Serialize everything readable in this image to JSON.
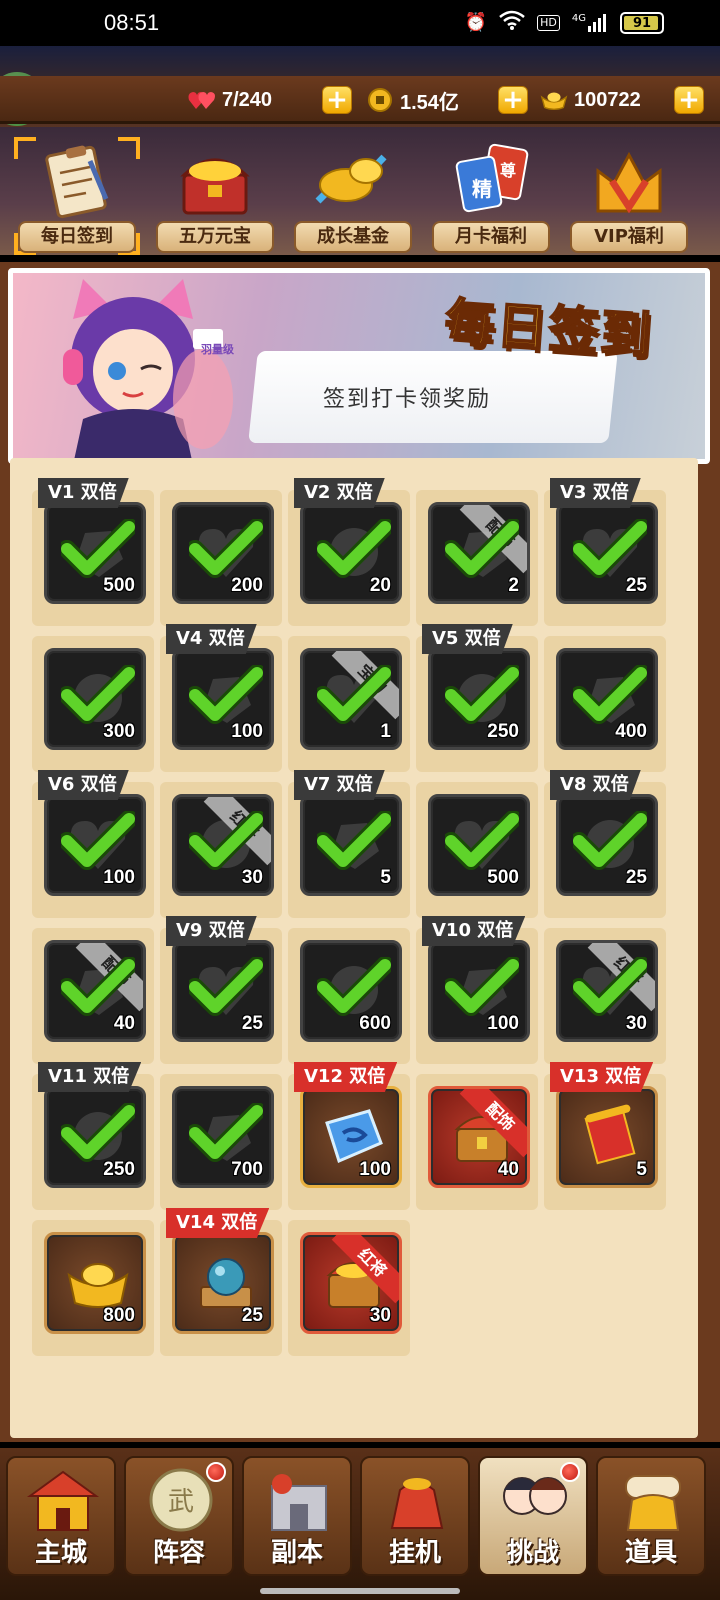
{
  "status_bar": {
    "time": "08:51",
    "net": "4G",
    "hd": "HD",
    "battery": "91"
  },
  "resources": {
    "stamina": "7/240",
    "coins": "1.54亿",
    "ingots": "100722"
  },
  "tabs": [
    {
      "label": "每日签到",
      "active": true,
      "icon": "clipboard-icon"
    },
    {
      "label": "五万元宝",
      "active": false,
      "icon": "treasure-chest-icon"
    },
    {
      "label": "成长基金",
      "active": false,
      "icon": "gold-growth-icon"
    },
    {
      "label": "月卡福利",
      "active": false,
      "icon": "month-card-icon",
      "badges": [
        "精",
        "尊"
      ]
    },
    {
      "label": "VIP福利",
      "active": false,
      "icon": "vip-crown-icon"
    }
  ],
  "banner": {
    "title": "每日签到",
    "subtitle": "签到打卡领奖励",
    "sign_text": "羽量级"
  },
  "checkins": [
    {
      "tag": "V1 双倍",
      "count": "500",
      "claimed": true
    },
    {
      "tag": "",
      "count": "200",
      "claimed": true
    },
    {
      "tag": "V2 双倍",
      "count": "20",
      "claimed": true
    },
    {
      "tag": "",
      "count": "2",
      "claimed": true,
      "ribbon": "配饰"
    },
    {
      "tag": "V3 双倍",
      "count": "25",
      "claimed": true
    },
    {
      "tag": "",
      "count": "300",
      "claimed": true
    },
    {
      "tag": "V4 双倍",
      "count": "100",
      "claimed": true
    },
    {
      "tag": "",
      "count": "1",
      "claimed": true,
      "ribbon": "宝物"
    },
    {
      "tag": "V5 双倍",
      "count": "250",
      "claimed": true
    },
    {
      "tag": "",
      "count": "400",
      "claimed": true
    },
    {
      "tag": "V6 双倍",
      "count": "100",
      "claimed": true
    },
    {
      "tag": "",
      "count": "30",
      "claimed": true,
      "ribbon": "红将"
    },
    {
      "tag": "V7 双倍",
      "count": "5",
      "claimed": true
    },
    {
      "tag": "",
      "count": "500",
      "claimed": true
    },
    {
      "tag": "V8 双倍",
      "count": "25",
      "claimed": true
    },
    {
      "tag": "",
      "count": "40",
      "claimed": true,
      "ribbon": "配饰"
    },
    {
      "tag": "V9 双倍",
      "count": "25",
      "claimed": true
    },
    {
      "tag": "",
      "count": "600",
      "claimed": true
    },
    {
      "tag": "V10 双倍",
      "count": "100",
      "claimed": true
    },
    {
      "tag": "",
      "count": "30",
      "claimed": true,
      "ribbon": "红将"
    },
    {
      "tag": "V11 双倍",
      "count": "250",
      "claimed": true
    },
    {
      "tag": "",
      "count": "700",
      "claimed": true
    },
    {
      "tag": "V12 双倍",
      "count": "100",
      "claimed": false,
      "icon": "blue-stone-icon"
    },
    {
      "tag": "",
      "count": "40",
      "claimed": false,
      "ribbon": "配饰",
      "icon": "accessory-chest-icon"
    },
    {
      "tag": "V13 双倍",
      "count": "5",
      "claimed": false,
      "icon": "red-scroll-icon"
    },
    {
      "tag": "",
      "count": "800",
      "claimed": false,
      "icon": "gold-ingot-icon"
    },
    {
      "tag": "V14 双倍",
      "count": "25",
      "claimed": false,
      "icon": "crystal-ball-icon"
    },
    {
      "tag": "",
      "count": "30",
      "claimed": false,
      "ribbon": "红将",
      "icon": "hero-chest-icon"
    }
  ],
  "bottom_nav": [
    {
      "label": "主城",
      "badge": false,
      "active": false
    },
    {
      "label": "阵容",
      "badge": true,
      "active": false
    },
    {
      "label": "副本",
      "badge": false,
      "active": false
    },
    {
      "label": "挂机",
      "badge": false,
      "active": false
    },
    {
      "label": "挑战",
      "badge": true,
      "active": true
    },
    {
      "label": "道具",
      "badge": false,
      "active": false
    }
  ],
  "colors": {
    "accent_gold": "#ffcc33",
    "check_green": "#5fd32a",
    "vip_red": "#d8302a"
  }
}
